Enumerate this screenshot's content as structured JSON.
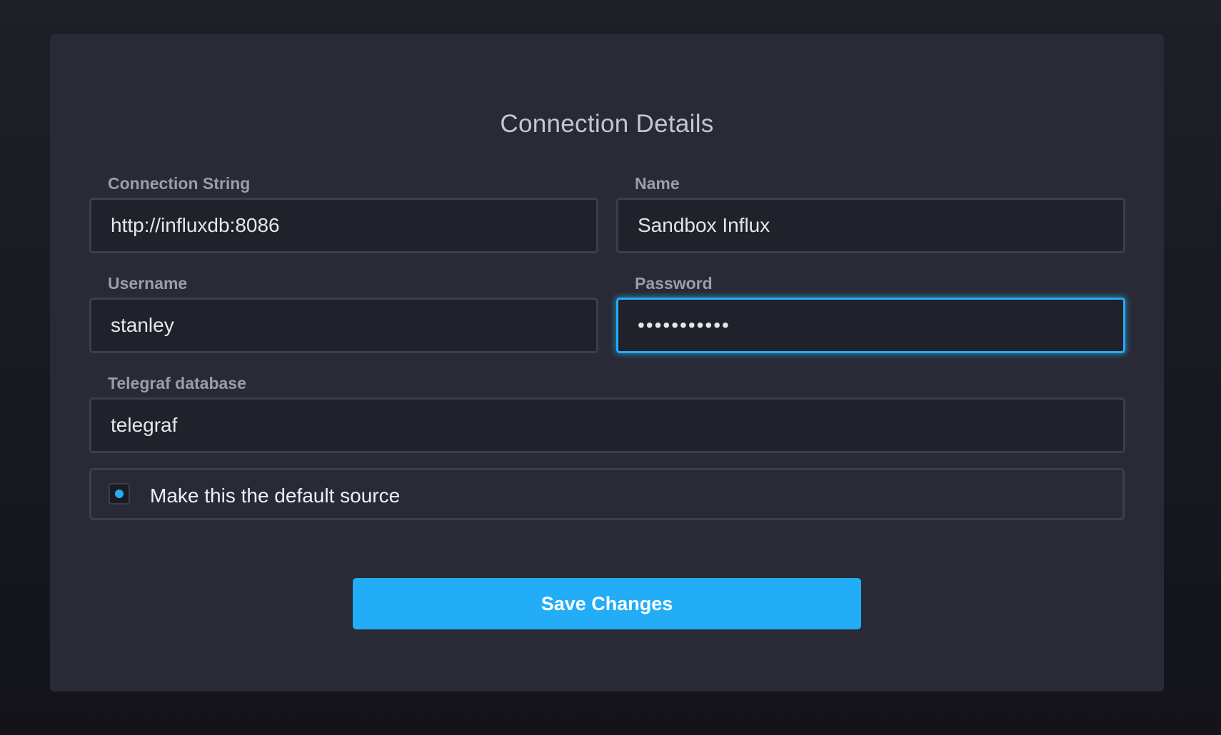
{
  "form": {
    "title": "Connection Details",
    "connection_string": {
      "label": "Connection String",
      "value": "http://influxdb:8086"
    },
    "name": {
      "label": "Name",
      "value": "Sandbox Influx"
    },
    "username": {
      "label": "Username",
      "value": "stanley"
    },
    "password": {
      "label": "Password",
      "value": "•••••••••••"
    },
    "telegraf_database": {
      "label": "Telegraf database",
      "value": "telegraf"
    },
    "default_source": {
      "label": "Make this the default source",
      "checked": true
    },
    "save_label": "Save Changes"
  },
  "colors": {
    "accent": "#22adf6",
    "panel": "#292a35",
    "input_bg": "#20212a",
    "border": "#3c3e4b"
  }
}
